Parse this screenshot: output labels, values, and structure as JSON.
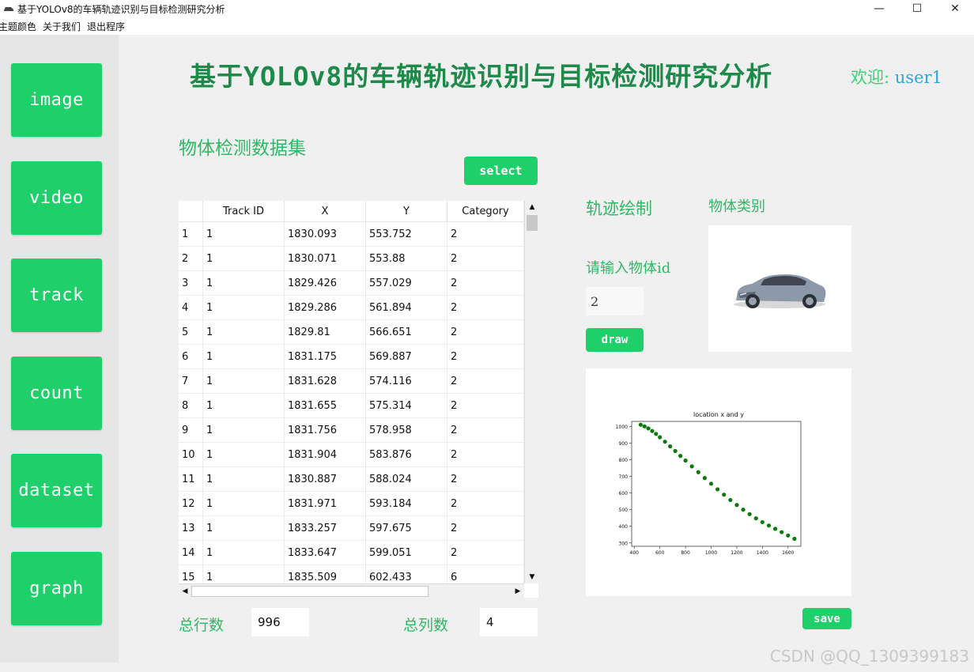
{
  "window": {
    "title": "基于YOLOv8的车辆轨迹识别与目标检测研究分析",
    "controls": [
      "—",
      "☐",
      "✕"
    ]
  },
  "menu": [
    "主题颜色",
    "关于我们",
    "退出程序"
  ],
  "sidebar": {
    "items": [
      {
        "label": "image"
      },
      {
        "label": "video"
      },
      {
        "label": "track"
      },
      {
        "label": "count"
      },
      {
        "label": "dataset"
      },
      {
        "label": "graph"
      }
    ]
  },
  "header": {
    "title": "基于YOLOv8的车辆轨迹识别与目标检测研究分析",
    "welcome_label": "欢迎:",
    "username": "user1"
  },
  "dataset": {
    "section_title": "物体检测数据集",
    "select_label": "select",
    "columns": [
      "",
      "Track ID",
      "X",
      "Y",
      "Category"
    ],
    "rows": [
      [
        "1",
        "1",
        "1830.093",
        "553.752",
        "2"
      ],
      [
        "2",
        "1",
        "1830.071",
        "553.88",
        "2"
      ],
      [
        "3",
        "1",
        "1829.426",
        "557.029",
        "2"
      ],
      [
        "4",
        "1",
        "1829.286",
        "561.894",
        "2"
      ],
      [
        "5",
        "1",
        "1829.81",
        "566.651",
        "2"
      ],
      [
        "6",
        "1",
        "1831.175",
        "569.887",
        "2"
      ],
      [
        "7",
        "1",
        "1831.628",
        "574.116",
        "2"
      ],
      [
        "8",
        "1",
        "1831.655",
        "575.314",
        "2"
      ],
      [
        "9",
        "1",
        "1831.756",
        "578.958",
        "2"
      ],
      [
        "10",
        "1",
        "1831.904",
        "583.876",
        "2"
      ],
      [
        "11",
        "1",
        "1830.887",
        "588.024",
        "2"
      ],
      [
        "12",
        "1",
        "1831.971",
        "593.184",
        "2"
      ],
      [
        "13",
        "1",
        "1833.257",
        "597.675",
        "2"
      ],
      [
        "14",
        "1",
        "1833.647",
        "599.051",
        "2"
      ],
      [
        "15",
        "1",
        "1835.509",
        "602.433",
        "6"
      ]
    ],
    "total_rows_label": "总行数",
    "total_rows": "996",
    "total_cols_label": "总列数",
    "total_cols": "4"
  },
  "track": {
    "section_title": "轨迹绘制",
    "category_title": "物体类别",
    "id_prompt": "请输入物体id",
    "id_value": "2",
    "draw_label": "draw",
    "save_label": "save"
  },
  "chart_data": {
    "type": "scatter",
    "title": "location x and y",
    "xlabel": "",
    "ylabel": "",
    "xlim": [
      380,
      1700
    ],
    "ylim": [
      280,
      1030
    ],
    "xticks": [
      400,
      600,
      800,
      1000,
      1200,
      1400,
      1600
    ],
    "yticks": [
      300,
      400,
      500,
      600,
      700,
      800,
      900,
      1000
    ],
    "series": [
      {
        "color": "#0a7a0a",
        "x": [
          450,
          480,
          510,
          540,
          570,
          600,
          640,
          680,
          720,
          760,
          800,
          850,
          900,
          950,
          1000,
          1050,
          1100,
          1150,
          1200,
          1250,
          1300,
          1350,
          1400,
          1450,
          1500,
          1550,
          1600,
          1650
        ],
        "y": [
          1010,
          1000,
          988,
          972,
          955,
          935,
          908,
          880,
          852,
          823,
          795,
          760,
          725,
          690,
          656,
          622,
          590,
          558,
          528,
          500,
          473,
          448,
          425,
          405,
          385,
          365,
          345,
          325
        ]
      }
    ]
  },
  "watermark": "CSDN @QQ_1309399183",
  "colors": {
    "accent": "#1fcf6a",
    "title": "#1d8a4a",
    "label": "#2fb866",
    "username": "#2aa9d8"
  }
}
